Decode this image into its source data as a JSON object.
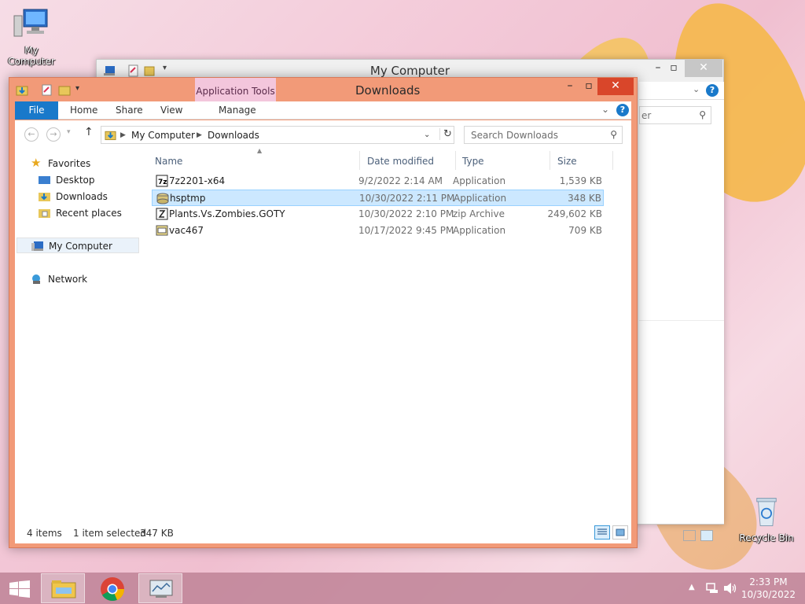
{
  "desktop": {
    "my_computer_label": "My Computer",
    "recycle_bin_label": "Recycle Bin"
  },
  "back_window": {
    "title": "My Computer",
    "search_fragment": "er"
  },
  "window": {
    "title": "Downloads",
    "contextual_tab": "Application Tools",
    "ribbon_tabs": [
      "File",
      "Home",
      "Share",
      "View",
      "Manage"
    ],
    "address": {
      "segments": [
        "My Computer",
        "Downloads"
      ]
    },
    "search": {
      "placeholder": "Search Downloads"
    },
    "nav_pane": {
      "favorites": "Favorites",
      "desktop": "Desktop",
      "downloads": "Downloads",
      "recent_places": "Recent places",
      "my_computer": "My Computer",
      "network": "Network"
    },
    "columns": [
      "Name",
      "Date modified",
      "Type",
      "Size"
    ],
    "files": [
      {
        "name": "7z2201-x64",
        "date": "9/2/2022 2:14 AM",
        "type": "Application",
        "size": "1,539 KB"
      },
      {
        "name": "hsptmp",
        "date": "10/30/2022 2:11 PM",
        "type": "Application",
        "size": "348 KB"
      },
      {
        "name": "Plants.Vs.Zombies.GOTY",
        "date": "10/30/2022 2:10 PM",
        "type": "zip Archive",
        "size": "249,602 KB"
      },
      {
        "name": "vac467",
        "date": "10/17/2022 9:45 PM",
        "type": "Application",
        "size": "709 KB"
      }
    ],
    "status": {
      "item_count": "4 items",
      "selected": "1 item selected",
      "selected_size": "347 KB"
    }
  },
  "taskbar": {
    "time": "2:33 PM",
    "date": "10/30/2022"
  }
}
